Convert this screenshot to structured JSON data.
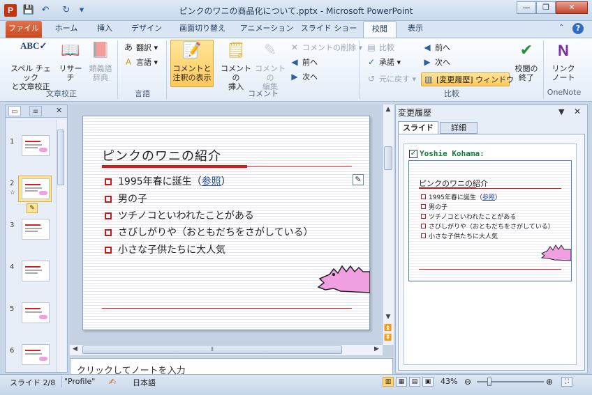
{
  "window": {
    "title": "ピンクのワニの商品化について.pptx - Microsoft PowerPoint",
    "app_icon": "P"
  },
  "ribbon": {
    "tabs": [
      "ファイル",
      "ホーム",
      "挿入",
      "デザイン",
      "画面切り替え",
      "アニメーション",
      "スライド ショー",
      "校閲",
      "表示"
    ],
    "active_tab": "校閲",
    "groups": {
      "proofing": {
        "label": "文章校正",
        "spell": "スペル チェック\nと文章校正",
        "research": "リサーチ",
        "thesaurus": "類義語\n辞典"
      },
      "language": {
        "label": "言語",
        "translate": "翻訳",
        "language": "言語"
      },
      "comments": {
        "label": "コメント",
        "show_markup": "コメントと\n注釈の表示",
        "new": "コメントの\n挿入",
        "edit": "コメントの\n編集",
        "delete": "コメントの削除",
        "prev": "前へ",
        "next": "次へ"
      },
      "compare": {
        "label": "比較",
        "compare": "比較",
        "accept": "承諾",
        "reject": "元に戻す",
        "prev": "前へ",
        "next": "次へ",
        "reviewing_pane": "[変更履歴] ウィンドウ",
        "end_review": "校閲の\n終了"
      },
      "onenote": {
        "label": "OneNote",
        "linked_notes": "リンク\nノート"
      }
    }
  },
  "thumbnails": {
    "numbers": [
      "1",
      "2",
      "3",
      "4",
      "5",
      "6"
    ],
    "selected": "2",
    "star": "☆"
  },
  "slide": {
    "title": "ピンクのワニの紹介",
    "bullets": [
      {
        "text": "1995年春に誕生（",
        "link": "参照",
        "tail": "）"
      },
      {
        "text": "男の子"
      },
      {
        "text": "ツチノコといわれたことがある"
      },
      {
        "text": "さびしがりや（おともだちをさがしている）"
      },
      {
        "text": "小さな子供たちに大人気"
      }
    ]
  },
  "notes": {
    "placeholder": "クリックしてノートを入力"
  },
  "revisions": {
    "title": "変更履歴",
    "tab_slide": "スライド",
    "tab_detail": "詳細",
    "user": "Yoshie Kohama:",
    "checked": true,
    "mini_title": "ピンクのワニの紹介",
    "mini_bullets": [
      {
        "text": "1995年春に誕生（",
        "link": "参照",
        "tail": "）"
      },
      {
        "text": "男の子"
      },
      {
        "text": "ツチノコといわれたことがある"
      },
      {
        "text": "さびしがりや（おともだちをさがしている）"
      },
      {
        "text": "小さな子供たちに大人気"
      }
    ]
  },
  "status": {
    "slide": "スライド 2/8",
    "theme": "\"Profile\"",
    "language": "日本語",
    "zoom": "43%",
    "zoom_value": 43
  },
  "colors": {
    "accent_red": "#d01c1c",
    "highlight": "#ffc85a",
    "file_tab": "#c8491f",
    "croc_pink": "#f0a0e0"
  }
}
